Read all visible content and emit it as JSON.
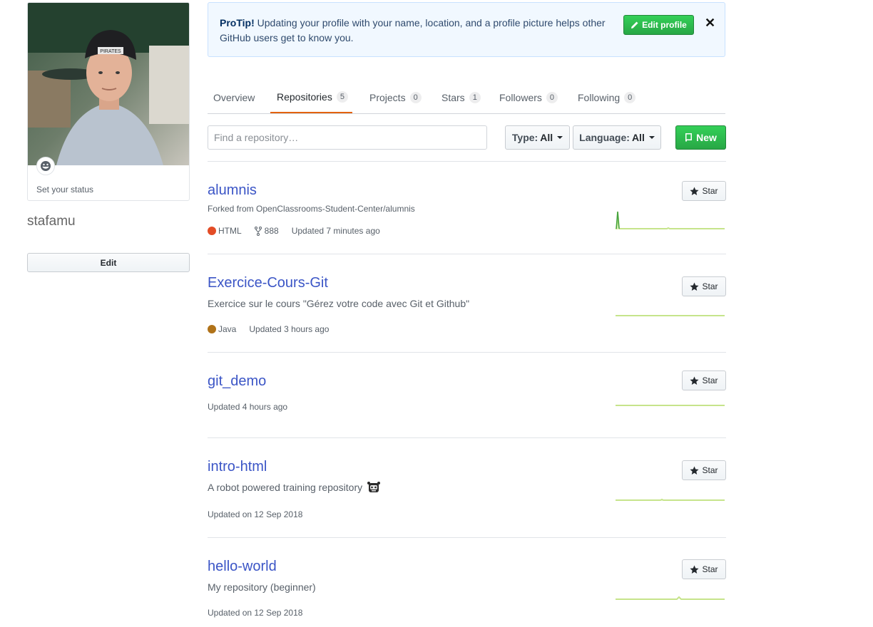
{
  "profile": {
    "status_text": "Set your status",
    "username": "stafamu",
    "edit_label": "Edit",
    "avatar_cap_text": "PIRATES"
  },
  "protip": {
    "bold": "ProTip!",
    "text": " Updating your profile with your name, location, and a profile picture helps other GitHub users get to know you.",
    "edit_label": "Edit profile",
    "close": "✕"
  },
  "tabs": [
    {
      "label": "Overview"
    },
    {
      "label": "Repositories",
      "count": "5",
      "selected": true
    },
    {
      "label": "Projects",
      "count": "0"
    },
    {
      "label": "Stars",
      "count": "1"
    },
    {
      "label": "Followers",
      "count": "0"
    },
    {
      "label": "Following",
      "count": "0"
    }
  ],
  "filters": {
    "search_placeholder": "Find a repository…",
    "type_label": "Type:",
    "type_value": "All",
    "language_label": "Language:",
    "language_value": "All",
    "new_label": "New"
  },
  "colors": {
    "accent_green": "#28a745",
    "link_blue": "#3b55c6",
    "tab_underline": "#e36209",
    "html_lang": "#e34c26",
    "java_lang": "#b07219"
  },
  "repos": [
    {
      "name": "alumnis",
      "fork": "Forked from OpenClassrooms-Student-Center/alumnis",
      "language": "HTML",
      "forks": "888",
      "updated": "Updated 7 minutes ago",
      "star_label": "Star"
    },
    {
      "name": "Exercice-Cours-Git",
      "description": "Exercice sur le cours \"Gérez votre code avec Git et Github\"",
      "language": "Java",
      "updated": "Updated 3 hours ago",
      "star_label": "Star"
    },
    {
      "name": "git_demo",
      "updated": "Updated 4 hours ago",
      "star_label": "Star"
    },
    {
      "name": "intro-html",
      "description": "A robot powered training repository",
      "updated": "Updated on 12 Sep 2018",
      "star_label": "Star"
    },
    {
      "name": "hello-world",
      "description": "My repository (beginner)",
      "updated": "Updated on 12 Sep 2018",
      "star_label": "Star"
    }
  ]
}
